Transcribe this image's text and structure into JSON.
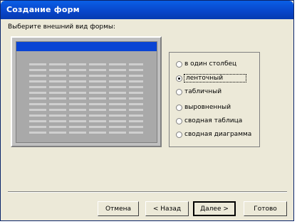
{
  "window": {
    "title": "Создание форм"
  },
  "prompt": "Выберите внешний вид формы:",
  "options": [
    {
      "label": "в один столбец",
      "selected": false
    },
    {
      "label": "ленточный",
      "selected": true
    },
    {
      "label": "табличный",
      "selected": false
    },
    {
      "label": "выровненный",
      "selected": false
    },
    {
      "label": "сводная таблица",
      "selected": false
    },
    {
      "label": "сводная диаграмма",
      "selected": false
    }
  ],
  "buttons": {
    "cancel": "Отмена",
    "back": "< Назад",
    "next": "Далее >",
    "finish": "Готово"
  },
  "colors": {
    "title_bar": "#0845c9",
    "preview_highlight": "#0a44d4",
    "dialog_bg": "#ece9d8"
  }
}
